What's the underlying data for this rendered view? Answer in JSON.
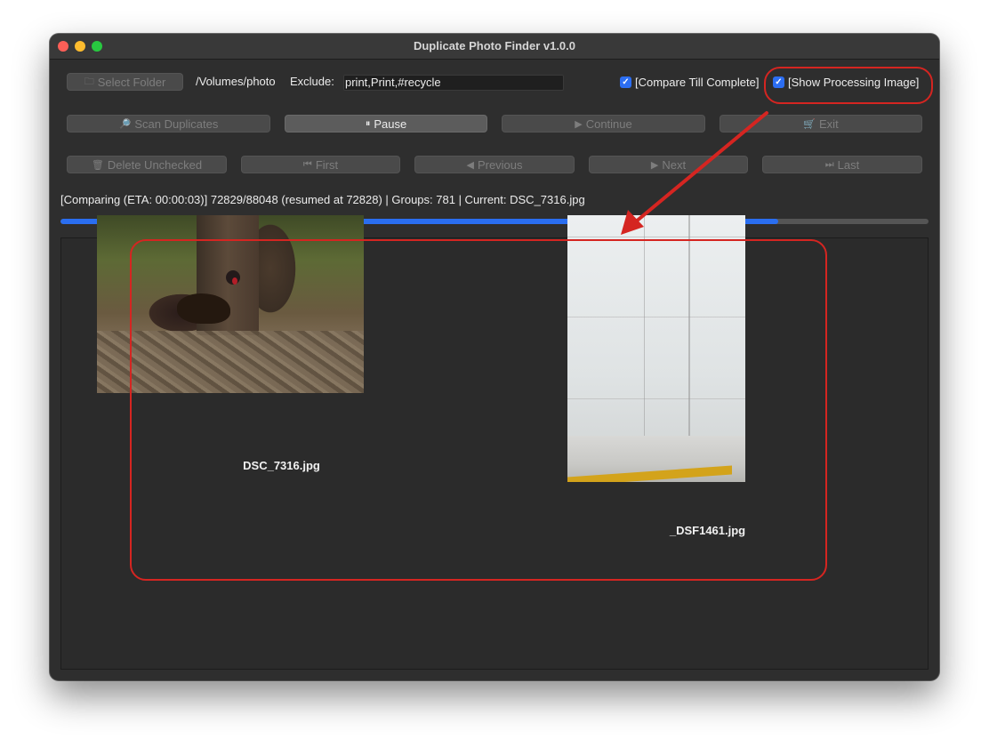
{
  "window": {
    "title": "Duplicate Photo Finder v1.0.0"
  },
  "toolbar_row1": {
    "select_folder_label": "Select Folder",
    "folder_icon": "folder-icon",
    "folder_path": "/Volumes/photo",
    "exclude_label": "Exclude:",
    "exclude_value": "print,Print,#recycle",
    "compare_till_complete_label": "[Compare Till Complete]",
    "compare_till_complete_checked": true,
    "show_processing_image_label": "[Show Processing Image]",
    "show_processing_image_checked": true
  },
  "toolbar_row2": {
    "scan_label": "Scan Duplicates",
    "scan_icon": "magnifier-icon",
    "pause_label": "Pause",
    "pause_icon": "pause-icon",
    "continue_label": "Continue",
    "continue_icon": "play-icon",
    "exit_label": "Exit",
    "exit_icon": "cart-icon"
  },
  "toolbar_row3": {
    "delete_label": "Delete Unchecked",
    "delete_icon": "trash-icon",
    "first_label": "First",
    "previous_label": "Previous",
    "next_label": "Next",
    "last_label": "Last"
  },
  "status": {
    "text": "[Comparing (ETA: 00:00:03)] 72829/88048 (resumed at 72828) | Groups: 781 | Current: DSC_7316.jpg"
  },
  "progress": {
    "value": 0.8271,
    "fill_color": "#2a6ef0"
  },
  "images": [
    {
      "caption": "DSC_7316.jpg"
    },
    {
      "caption": "_DSF1461.jpg"
    }
  ],
  "annotation_color": "#d52521"
}
